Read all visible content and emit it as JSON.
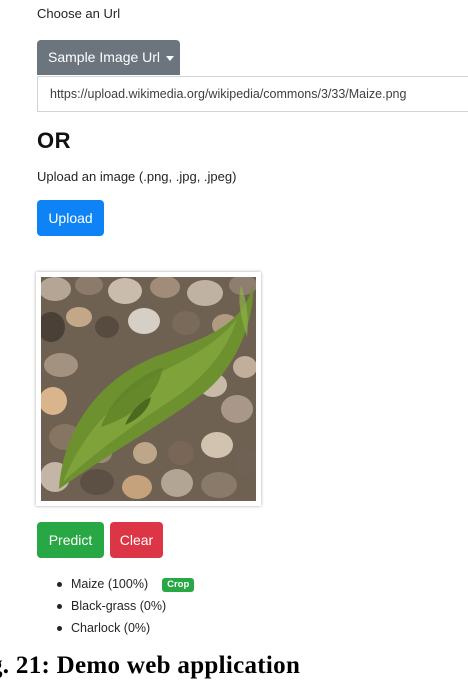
{
  "url_section": {
    "label": "Choose an Url",
    "dropdown_label": "Sample Image Url",
    "url_value": "https://upload.wikimedia.org/wikipedia/commons/3/33/Maize.png"
  },
  "or_heading": "OR",
  "upload_section": {
    "label": "Upload an image (.png, .jpg, .jpeg)",
    "button_label": "Upload"
  },
  "actions": {
    "predict_label": "Predict",
    "clear_label": "Clear"
  },
  "results": [
    {
      "label": "Maize (100%)",
      "badge": "Crop"
    },
    {
      "label": "Black-grass (0%)"
    },
    {
      "label": "Charlock (0%)"
    }
  ],
  "caption": "g. 21: Demo web application",
  "colors": {
    "secondary": "#6c757d",
    "primary": "#0d83f5",
    "success": "#28a745",
    "danger": "#dc3545"
  }
}
